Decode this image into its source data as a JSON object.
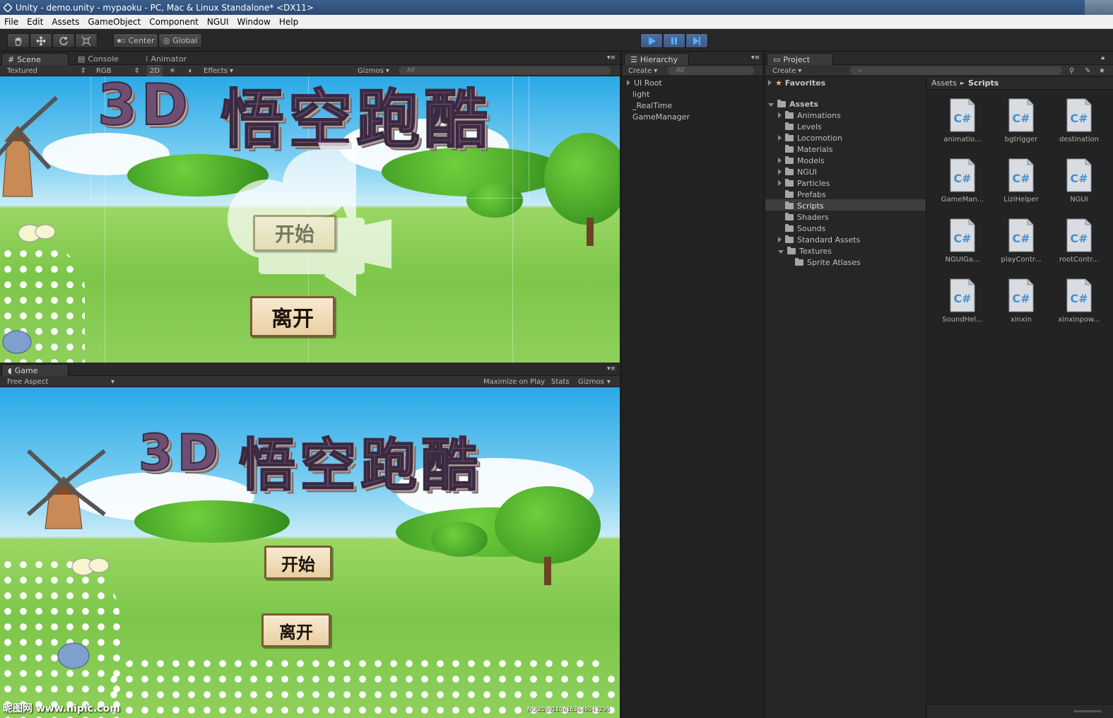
{
  "window": {
    "title": "Unity - demo.unity - mypaoku - PC, Mac & Linux Standalone* <DX11>"
  },
  "menu": [
    "File",
    "Edit",
    "Assets",
    "GameObject",
    "Component",
    "NGUI",
    "Window",
    "Help"
  ],
  "toolbar": {
    "pivot_center": "Center",
    "pivot_global": "Global"
  },
  "scene_panel": {
    "tabs": [
      "Scene",
      "Console",
      "Animator"
    ],
    "render_mode": "Textured",
    "color_mode": "RGB",
    "toggle_2d": "2D",
    "effects": "Effects",
    "gizmos": "Gizmos",
    "search_placeholder": "All"
  },
  "game_content": {
    "title_3d": "3D",
    "title_cn": "悟空跑酷",
    "start_button": "开始",
    "exit_button": "离开",
    "watermark_left": "昵图网 www.nipic.com",
    "watermark_right": "NO:20091106163646043236"
  },
  "game_panel": {
    "tab": "Game",
    "aspect": "Free Aspect",
    "maximize": "Maximize on Play",
    "stats": "Stats",
    "gizmos": "Gizmos"
  },
  "hierarchy": {
    "tab": "Hierarchy",
    "create": "Create",
    "search_placeholder": "All",
    "items": [
      "UI Root",
      "light",
      "_RealTime",
      "GameManager"
    ]
  },
  "project": {
    "tab": "Project",
    "create": "Create",
    "favorites": "Favorites",
    "assets_root": "Assets",
    "folders": [
      "Animations",
      "Levels",
      "Locomotion",
      "Materials",
      "Models",
      "NGUI",
      "Particles",
      "Prefabs",
      "Scripts",
      "Shaders",
      "Sounds",
      "Standard Assets",
      "Textures"
    ],
    "subfolder": "Sprite Atlases",
    "breadcrumb": [
      "Assets",
      "Scripts"
    ],
    "files": [
      "animatio...",
      "bgtrigger",
      "destination",
      "GameMan...",
      "LiziHelper",
      "NGUI",
      "NGUIGa...",
      "playContr...",
      "rootContr...",
      "SoundHel...",
      "xinxin",
      "xinxinpow..."
    ],
    "selected_folder": "Scripts"
  },
  "colors": {
    "play_blue": "#3d5a86",
    "selected_row": "#3e3e3e",
    "panel_bg": "#1f1f1f"
  }
}
